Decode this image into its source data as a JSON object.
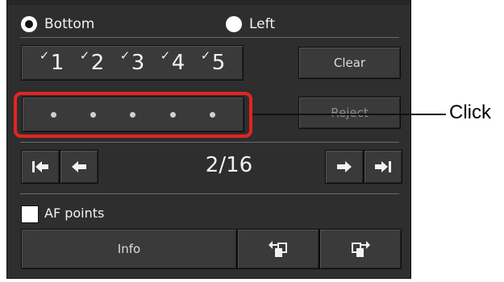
{
  "position_options": [
    {
      "label": "Bottom",
      "selected": true
    },
    {
      "label": "Left",
      "selected": false
    }
  ],
  "ratings": [
    {
      "check": "✓",
      "label": "1"
    },
    {
      "check": "✓",
      "label": "2"
    },
    {
      "check": "✓",
      "label": "3"
    },
    {
      "check": "✓",
      "label": "4"
    },
    {
      "check": "✓",
      "label": "5"
    }
  ],
  "clear_label": "Clear",
  "reject_label": "Reject",
  "rating_dots_count": 5,
  "counter": "2/16",
  "nav_icons": {
    "first": "skip-to-first-icon",
    "prev": "arrow-left-icon",
    "next": "arrow-right-icon",
    "last": "skip-to-last-icon"
  },
  "af_points": {
    "label": "AF points",
    "checked": false
  },
  "info_label": "Info",
  "rotate_icons": {
    "left": "rotate-left-icon",
    "right": "rotate-right-icon"
  },
  "callout": {
    "text": "Click",
    "color": "#e32424"
  },
  "colors": {
    "panel": "#2e2e2e",
    "button": "#3a3a3a",
    "highlight": "#e32424"
  }
}
